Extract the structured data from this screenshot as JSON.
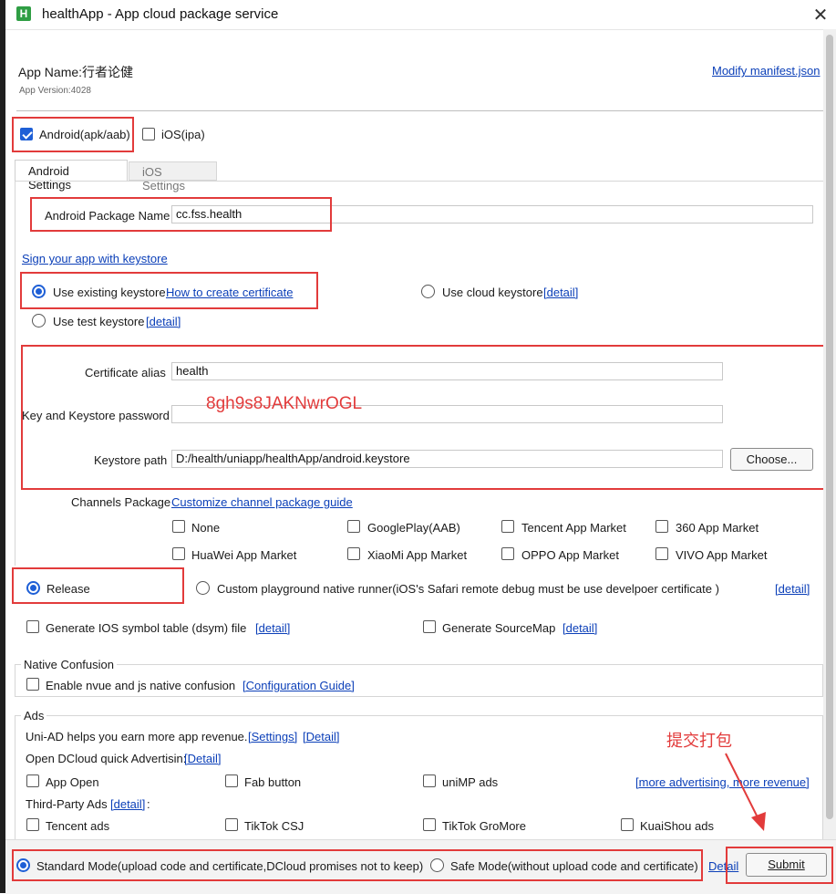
{
  "window": {
    "title": "healthApp - App cloud package service",
    "icon_letter": "H",
    "close_glyph": "✕"
  },
  "header": {
    "app_name": "App Name:行者论健",
    "app_version": "App Version:4028",
    "modify_manifest": "Modify manifest.json"
  },
  "platforms": {
    "android": "Android(apk/aab)",
    "ios": "iOS(ipa)"
  },
  "tabs": {
    "android": "Android Settings",
    "ios": "iOS Settings"
  },
  "android": {
    "package_label": "Android Package Name",
    "package_value": "cc.fss.health",
    "sign_link": "Sign your app with keystore",
    "use_existing": "Use existing keystore",
    "how_to_create": "How to create certificate",
    "use_cloud": "Use cloud keystore",
    "use_test": "Use test keystore",
    "detail": "[detail]",
    "cert_alias_label": "Certificate alias",
    "cert_alias_value": "health",
    "password_label": "Key and Keystore password",
    "password_annotation": "8gh9s8JAKNwrOGL",
    "keystore_path_label": "Keystore path",
    "keystore_path_value": "D:/health/uniapp/healthApp/android.keystore",
    "choose_button": "Choose...",
    "channels_label": "Channels Package",
    "channels_guide": "Customize channel package guide",
    "channels": [
      "None",
      "GooglePlay(AAB)",
      "Tencent App Market",
      "360 App Market",
      "HuaWei App Market",
      "XiaoMi App Market",
      "OPPO App Market",
      "VIVO App Market"
    ]
  },
  "build": {
    "release": "Release",
    "custom_runner": "Custom playground native runner(iOS's  Safari remote debug must be use develpoer certificate )",
    "detail": "[detail]",
    "dsym": "Generate IOS symbol table (dsym) file",
    "sourcemap": "Generate SourceMap"
  },
  "native_confusion": {
    "title": "Native Confusion",
    "enable": "Enable nvue and js native confusion",
    "guide": "[Configuration Guide]"
  },
  "ads": {
    "title": "Ads",
    "uniad_text": "Uni-AD helps you earn more app revenue.",
    "settings_link": "[Settings]",
    "detail_link": "[Detail]",
    "open_dcloud": "Open DCloud quick Advertisin:",
    "items_row1": [
      "App Open",
      "Fab button",
      "uniMP ads"
    ],
    "more_ads": "[more advertising, more revenue]",
    "third_party": "Third-Party Ads",
    "third_detail": "[detail]",
    "colon": ":",
    "items_row2": [
      "Tencent ads",
      "TikTok CSJ",
      "TikTok GroMore",
      "KuaiShou ads"
    ]
  },
  "annotation": {
    "submit_note": "提交打包"
  },
  "footer": {
    "standard_mode": "Standard Mode(upload code and certificate,DCloud promises not to keep)",
    "safe_mode": "Safe Mode(without upload code and certificate)",
    "detail": "Detail",
    "submit": "Submit"
  },
  "colors": {
    "accent": "#1e5fd6",
    "annotation_red": "#e23b3b",
    "link": "#0b3fb8"
  }
}
